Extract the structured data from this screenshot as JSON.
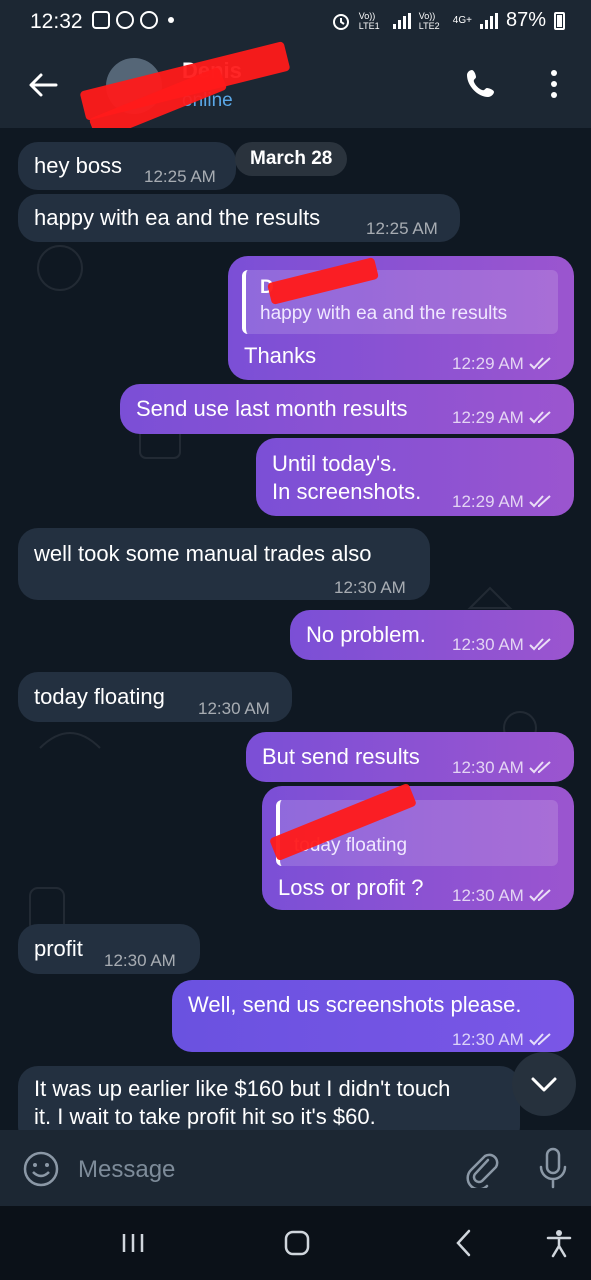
{
  "status_bar": {
    "time": "12:32",
    "network_1": "Vo)) LTE1",
    "network_2": "Vo)) LTE2",
    "network_type": "4G+",
    "battery": "87%"
  },
  "header": {
    "contact_name": "Denis",
    "contact_status": "online"
  },
  "chat": {
    "date_chip": "March 28",
    "messages": [
      {
        "text": "hey boss",
        "time": "12:25 AM"
      },
      {
        "text": "happy with ea and the results",
        "time": "12:25 AM"
      },
      {
        "quote_name": "D",
        "quote_text": "happy with ea and the results",
        "text": "Thanks",
        "time": "12:29 AM"
      },
      {
        "text": "Send use last month results",
        "time": "12:29 AM"
      },
      {
        "line1": "Until today's.",
        "line2": "In screenshots.",
        "time": "12:29 AM"
      },
      {
        "text": "well took some manual trades also",
        "time": "12:30 AM"
      },
      {
        "text": "No problem.",
        "time": "12:30 AM"
      },
      {
        "text": "today floating",
        "time": "12:30 AM"
      },
      {
        "text": "But send results",
        "time": "12:30 AM"
      },
      {
        "quote_text": "today floating",
        "text": "Loss or profit ?",
        "time": "12:30 AM"
      },
      {
        "text": "profit",
        "time": "12:30 AM"
      },
      {
        "text": "Well, send us screenshots please.",
        "time": "12:30 AM"
      },
      {
        "line1": "It was up earlier like $160 but I didn't touch",
        "line2": "it. I wait to take profit hit so it's $60."
      }
    ]
  },
  "composer": {
    "placeholder": "Message"
  },
  "colors": {
    "incoming": "#233040",
    "outgoing": "#8b52d2",
    "background": "#0f1822",
    "header": "#1c2733",
    "link": "#5aa7e6"
  },
  "icons": [
    "back-arrow-icon",
    "phone-icon",
    "more-vertical-icon",
    "double-check-icon",
    "chevron-down-icon",
    "emoji-icon",
    "paperclip-icon",
    "microphone-icon",
    "recents-icon",
    "home-icon",
    "nav-back-icon",
    "accessibility-icon"
  ]
}
